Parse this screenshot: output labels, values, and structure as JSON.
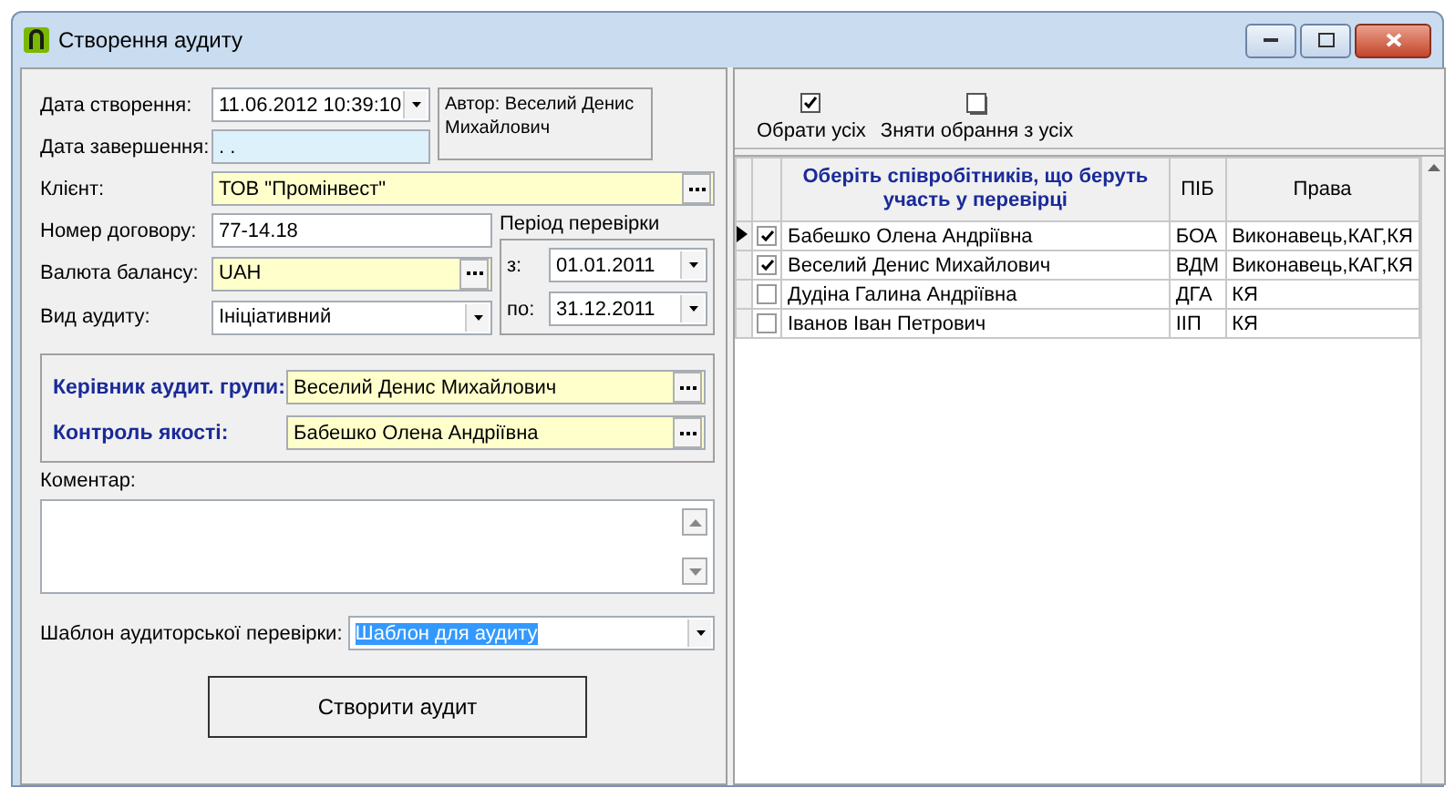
{
  "window": {
    "title": "Створення аудиту"
  },
  "form": {
    "created": {
      "label": "Дата створення:",
      "value": "11.06.2012 10:39:10"
    },
    "author": "Автор: Веселий Денис Михайлович",
    "completed": {
      "label": "Дата завершення:",
      "value": ". ."
    },
    "client": {
      "label": "Клієнт:",
      "value": "ТОВ \"Промінвест\""
    },
    "contract": {
      "label": "Номер договору:",
      "value": "77-14.18"
    },
    "currency": {
      "label": "Валюта балансу:",
      "value": "UAH"
    },
    "audit_type": {
      "label": "Вид аудиту:",
      "value": "Ініціативний"
    },
    "period": {
      "title": "Період перевірки",
      "from_label": "з:",
      "from": "01.01.2011",
      "to_label": "по:",
      "to": "31.12.2011"
    },
    "lead": {
      "label": "Керівник аудит. групи:",
      "value": "Веселий Денис Михайлович"
    },
    "quality": {
      "label": "Контроль якості:",
      "value": "Бабешко Олена Андріївна"
    },
    "comment": {
      "label": "Коментар:"
    },
    "template": {
      "label": "Шаблон аудиторської перевірки:",
      "value": "Шаблон для аудиту",
      "highlighted": true
    },
    "create_button": "Створити аудит"
  },
  "toolbar": [
    {
      "label": "Обрати усіх",
      "kind": "check"
    },
    {
      "label": "Зняти обрання з усіх",
      "kind": "uncheck"
    }
  ],
  "grid": {
    "columns": [
      "Оберіть співробітників, що беруть участь у перевірці",
      "ПІБ",
      "Права"
    ],
    "rows": [
      {
        "name": "Бабешко Олена Андріївна",
        "initials": "БОА",
        "rights": "Виконавець,КАГ,КЯ",
        "checked": true,
        "selected": true
      },
      {
        "name": "Веселий Денис Михайлович",
        "initials": "ВДМ",
        "rights": "Виконавець,КАГ,КЯ",
        "checked": true,
        "selected": false
      },
      {
        "name": "Дудіна Галина Андріївна",
        "initials": "ДГА",
        "rights": "КЯ",
        "checked": false,
        "selected": false
      },
      {
        "name": "Іванов Іван Петрович",
        "initials": "ІІП",
        "rights": "КЯ",
        "checked": false,
        "selected": false
      }
    ]
  }
}
